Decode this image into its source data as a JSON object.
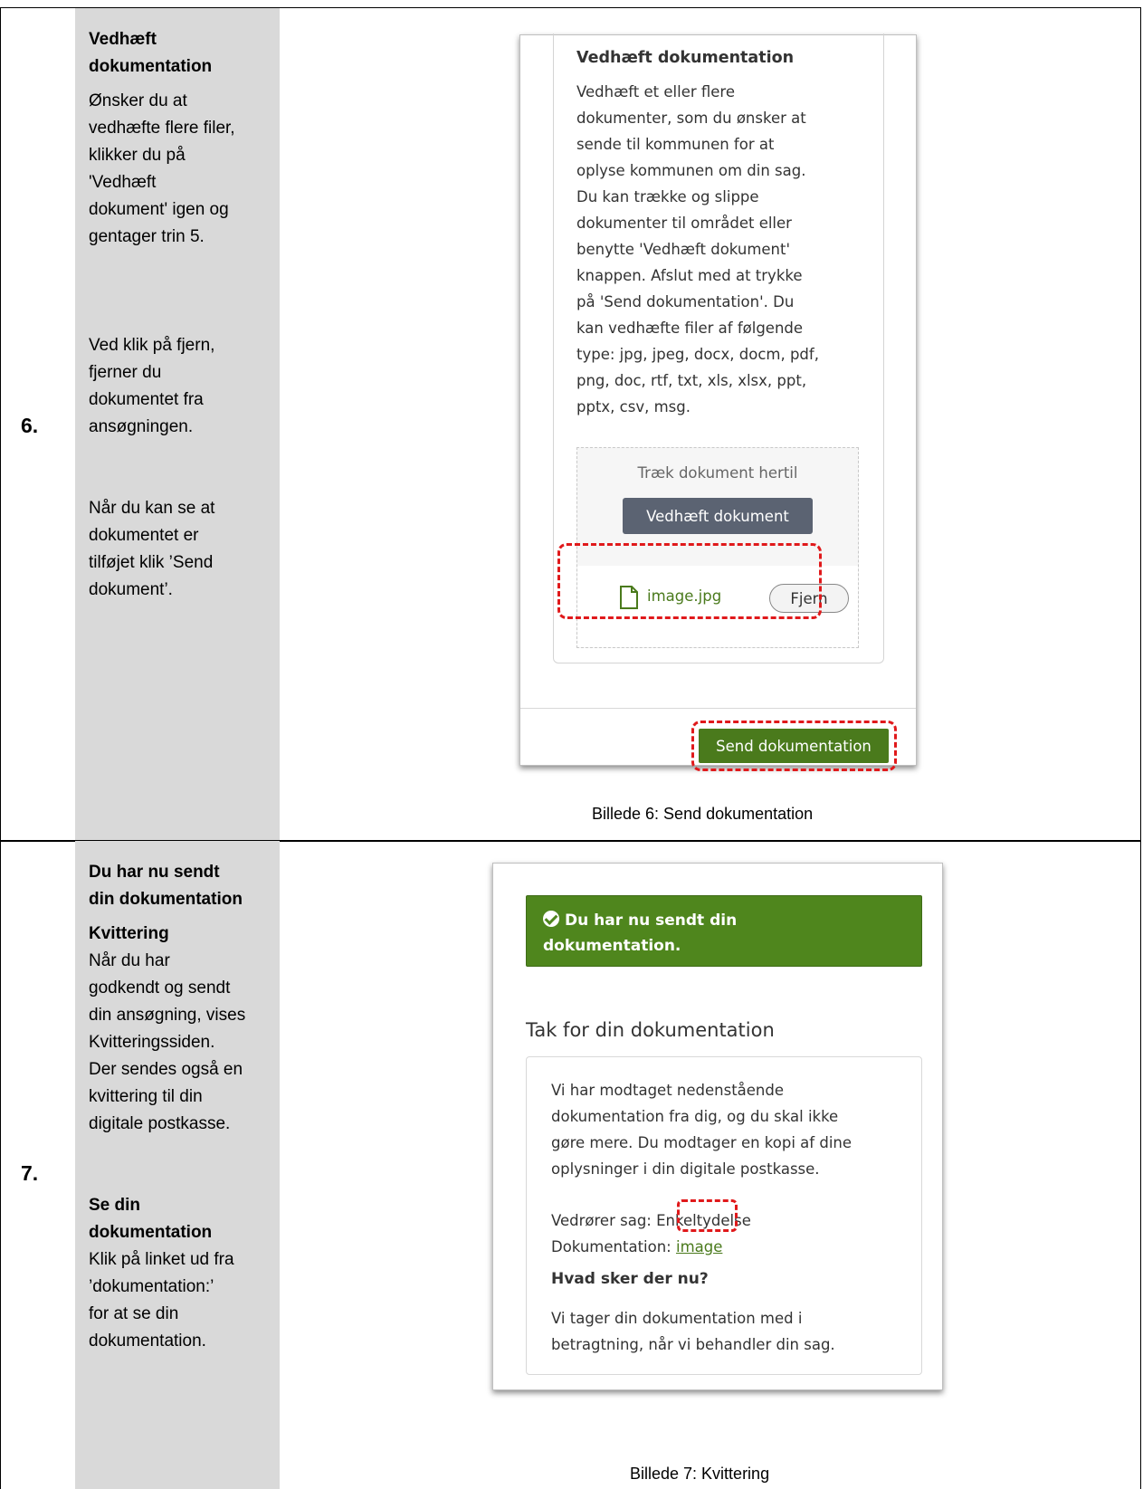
{
  "step6": {
    "number": "6.",
    "instructions": {
      "heading_line1": "Vedhæft",
      "heading_line2": "dokumentation",
      "p1": [
        "Ønsker du at",
        "vedhæfte flere filer,",
        "klikker du på",
        "'Vedhæft",
        "dokument' igen og",
        "gentager trin 5."
      ],
      "p2": [
        "Ved klik på fjern,",
        "fjerner du",
        "dokumentet fra",
        "ansøgningen."
      ],
      "p3": [
        "Når du kan se at",
        "dokumentet er",
        "tilføjet klik ’Send",
        "dokument’."
      ]
    },
    "screenshot": {
      "title": "Vedhæft dokumentation",
      "body_lines": [
        "Vedhæft et eller flere",
        "dokumenter, som du ønsker at",
        "sende til kommunen for at",
        "oplyse kommunen om din sag.",
        "Du kan trække og slippe",
        "dokumenter til området eller",
        "benytte 'Vedhæft dokument'",
        "knappen. Afslut med at trykke",
        "på 'Send dokumentation'. Du",
        "kan vedhæfte filer af følgende",
        "type: jpg, jpeg, docx, docm, pdf,",
        "png, doc, rtf, txt, xls, xlsx, ppt,",
        "pptx, csv, msg."
      ],
      "drop_text": "Træk dokument hertil",
      "attach_button": "Vedhæft dokument",
      "file_name": "image.jpg",
      "remove_button": "Fjern",
      "send_button": "Send dokumentation"
    },
    "caption": "Billede 6: Send dokumentation"
  },
  "step7": {
    "number": "7.",
    "instructions": {
      "heading_line1": "Du har nu sendt",
      "heading_line2": "din dokumentation",
      "sub1": "Kvittering",
      "p1": [
        "Når du har",
        "godkendt og sendt",
        "din ansøgning, vises",
        "Kvitteringssiden.",
        "Der sendes også en",
        "kvittering til din",
        "digitale postkasse."
      ],
      "sub2_line1": "Se din",
      "sub2_line2": "dokumentation",
      "p2": [
        "Klik på linket ud fra",
        "’dokumentation:’",
        "for at se din",
        "dokumentation."
      ]
    },
    "screenshot": {
      "banner_line1": "Du har nu sendt din",
      "banner_line2": "dokumentation.",
      "heading": "Tak for din dokumentation",
      "body_lines": [
        "Vi har modtaget nedenstående",
        "dokumentation fra dig, og du skal ikke",
        "gøre mere. Du modtager en kopi af dine",
        "oplysninger i din digitale postkasse."
      ],
      "case_line": "Vedrører sag: Enkeltydelse",
      "doc_label": "Dokumentation: ",
      "doc_link": "image",
      "next_heading": "Hvad sker der nu?",
      "next_lines": [
        "Vi tager din dokumentation med i",
        "betragtning, når vi behandler din sag."
      ]
    },
    "caption": "Billede 7: Kvittering"
  },
  "colors": {
    "accent_green": "#4f861d",
    "highlight_red": "#e0191b",
    "sidebar_gray": "#d9d9d9"
  }
}
